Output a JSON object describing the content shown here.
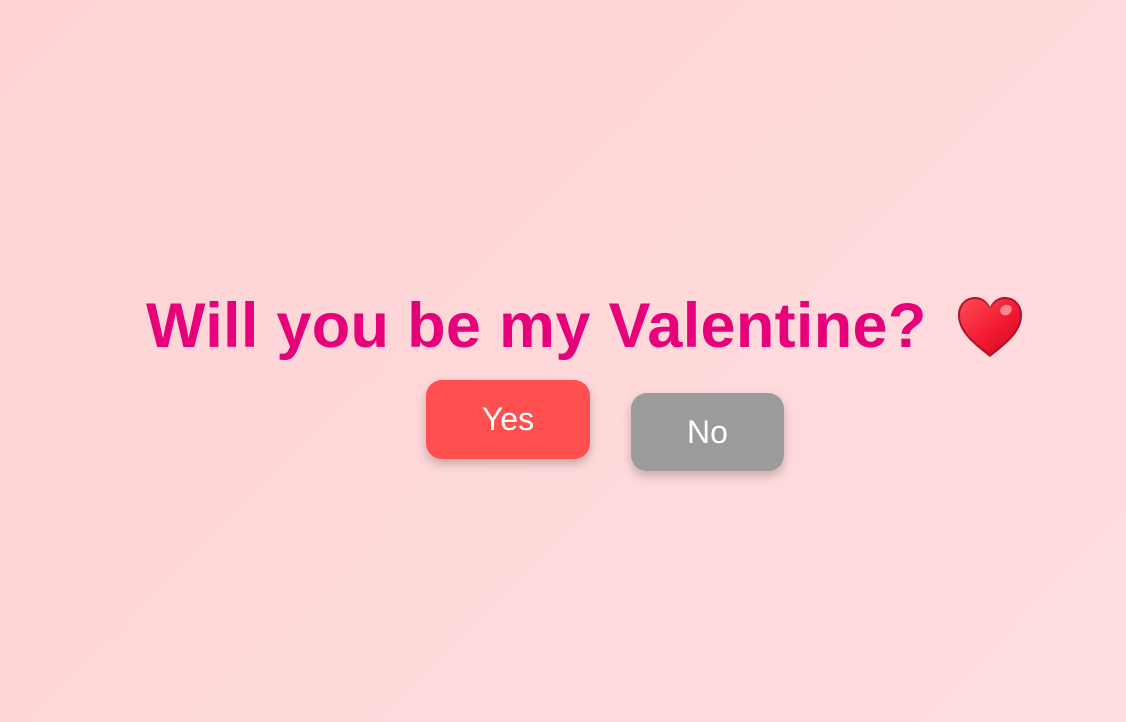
{
  "question": {
    "text": "Will you be my Valentine?",
    "emoji_icon": "red-heart-icon"
  },
  "buttons": {
    "yes_label": "Yes",
    "no_label": "No"
  },
  "colors": {
    "background": "#ffd6d8",
    "title": "#e6007a",
    "yes_button": "#ff4f4f",
    "no_button": "#9b9b9b",
    "heart": "#e8102c"
  }
}
